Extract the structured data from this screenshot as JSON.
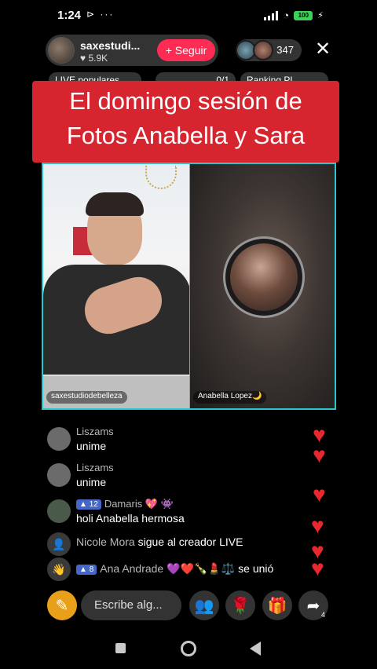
{
  "status": {
    "time": "1:24",
    "left_icons": "⊳ ···",
    "battery": "100"
  },
  "host": {
    "name": "saxestudi...",
    "likes": "♥ 5.9K",
    "follow_label": "+ Seguir"
  },
  "viewers": {
    "count": "347"
  },
  "ranking": [
    {
      "label": "LIVE populares"
    },
    {
      "label": "0/1"
    },
    {
      "label": "Ranking PL"
    }
  ],
  "caption": {
    "line1": "El domingo sesión de",
    "line2": "Fotos Anabella y Sara"
  },
  "panels": {
    "left_label": "saxestudiodebelleza",
    "right_label": "Anabella Lopez🌙"
  },
  "chat": [
    {
      "name": "Liszams",
      "text": "unime"
    },
    {
      "name": "Liszams",
      "text": "unime"
    },
    {
      "level": "12",
      "name": "Damaris 💖 👾",
      "text": "holi Anabella hermosa"
    },
    {
      "name": "Nicole Mora",
      "action": "sigue al creador LIVE"
    },
    {
      "level": "8",
      "name": "Ana Andrade 💜❤️🍾💄⚖️",
      "action": "se unió"
    }
  ],
  "bottom": {
    "comment_placeholder": "Escribe alg...",
    "share_count": "4"
  },
  "colors": {
    "accent": "#fe2c55",
    "caption_bg": "#d6252f",
    "panel_border": "#2ec4cc"
  }
}
